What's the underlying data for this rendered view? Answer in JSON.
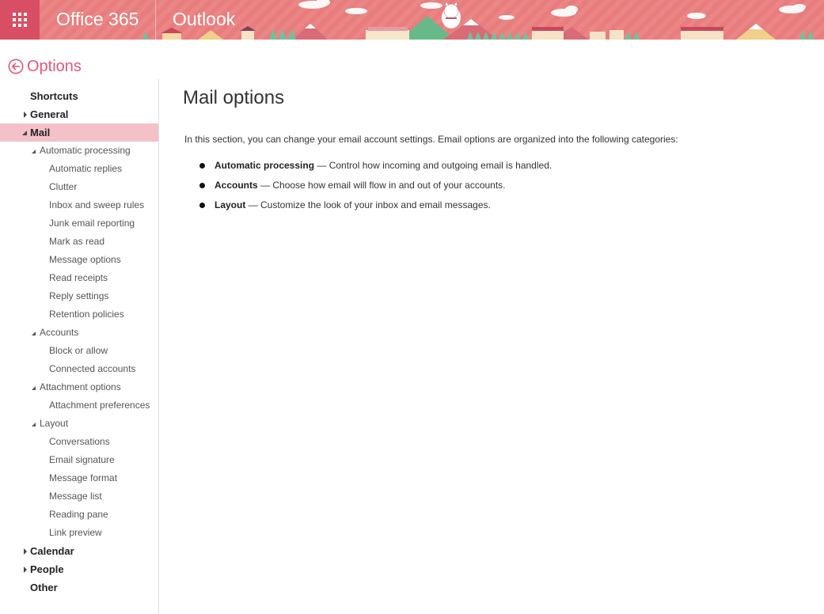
{
  "topbar": {
    "brand": "Office 365",
    "app": "Outlook",
    "colors": {
      "bar": "#e97c7c",
      "waffle": "#d84f63"
    },
    "icons": [
      "waffle-icon"
    ]
  },
  "options_header": {
    "title": "Options",
    "icon": "back-arrow-icon",
    "color": "#e0587a"
  },
  "nav": {
    "shortcuts": "Shortcuts",
    "general": "General",
    "mail": "Mail",
    "automatic_processing": "Automatic processing",
    "automatic_replies": "Automatic replies",
    "clutter": "Clutter",
    "inbox_sweep_rules": "Inbox and sweep rules",
    "junk_email_reporting": "Junk email reporting",
    "mark_as_read": "Mark as read",
    "message_options": "Message options",
    "read_receipts": "Read receipts",
    "reply_settings": "Reply settings",
    "retention_policies": "Retention policies",
    "accounts": "Accounts",
    "block_or_allow": "Block or allow",
    "connected_accounts": "Connected accounts",
    "attachment_options": "Attachment options",
    "attachment_preferences": "Attachment preferences",
    "layout": "Layout",
    "conversations": "Conversations",
    "email_signature": "Email signature",
    "message_format": "Message format",
    "message_list": "Message list",
    "reading_pane": "Reading pane",
    "link_preview": "Link preview",
    "calendar": "Calendar",
    "people": "People",
    "other": "Other",
    "selected_color": "#f4c1c9"
  },
  "main": {
    "title": "Mail options",
    "intro": "In this section, you can change your email account settings. Email options are organized into the following categories:",
    "bullets": [
      {
        "term": "Automatic processing",
        "desc": " — Control how incoming and outgoing email is handled."
      },
      {
        "term": "Accounts",
        "desc": " — Choose how email will flow in and out of your accounts."
      },
      {
        "term": "Layout",
        "desc": " — Customize the look of your inbox and email messages."
      }
    ]
  }
}
